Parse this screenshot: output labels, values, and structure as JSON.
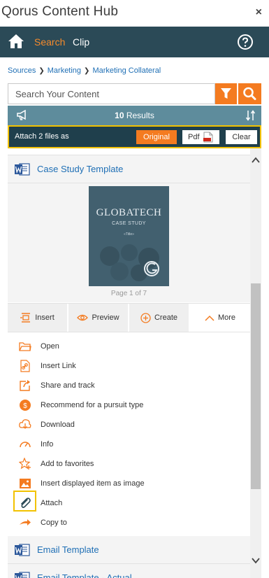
{
  "app": {
    "title": "Qorus Content Hub",
    "close_glyph": "×"
  },
  "nav": {
    "search_label": "Search",
    "clip_label": "Clip",
    "home_icon": "home-icon",
    "help_icon": "help-circle-icon",
    "accent": "#f68b2c",
    "bg": "#2b4a57"
  },
  "breadcrumb": [
    {
      "label": "Sources"
    },
    {
      "label": "Marketing"
    },
    {
      "label": "Marketing Collateral"
    }
  ],
  "search": {
    "placeholder": "Search Your Content",
    "value": ""
  },
  "results": {
    "count": "10",
    "label": "Results"
  },
  "attach_bar": {
    "label": "Attach 2 files as",
    "original_label": "Original",
    "pdf_label": "Pdf",
    "clear_label": "Clear"
  },
  "items": [
    {
      "title": "Case Study Template",
      "type_icon": "word-icon"
    },
    {
      "title": "Email Template",
      "type_icon": "word-icon"
    },
    {
      "title": "Email Template - Actual",
      "type_icon": "word-icon"
    }
  ],
  "preview": {
    "thumb_title": "GLOBATECH",
    "thumb_subtitle": "CASE STUDY",
    "thumb_line": "«Title»",
    "page_label": "Page 1 of 7"
  },
  "actions": {
    "insert_label": "Insert",
    "preview_label": "Preview",
    "create_label": "Create",
    "more_label": "More"
  },
  "menu": [
    {
      "label": "Open",
      "icon": "folder-open-icon"
    },
    {
      "label": "Insert Link",
      "icon": "insert-link-icon"
    },
    {
      "label": "Share and track",
      "icon": "share-icon"
    },
    {
      "label": "Recommend for a pursuit type",
      "icon": "recommend-icon"
    },
    {
      "label": "Download",
      "icon": "download-icon"
    },
    {
      "label": "Info",
      "icon": "info-gauge-icon"
    },
    {
      "label": "Add to favorites",
      "icon": "favorite-star-icon"
    },
    {
      "label": "Insert displayed item as image",
      "icon": "image-icon"
    },
    {
      "label": "Attach",
      "icon": "paperclip-icon"
    },
    {
      "label": "Copy to",
      "icon": "copy-to-arrow-icon"
    }
  ],
  "colors": {
    "orange": "#f47b20",
    "link": "#1f6fb5",
    "results_bar": "#5e8c9c",
    "attach_bar": "#1f3f4c",
    "highlight": "#f2c200"
  }
}
